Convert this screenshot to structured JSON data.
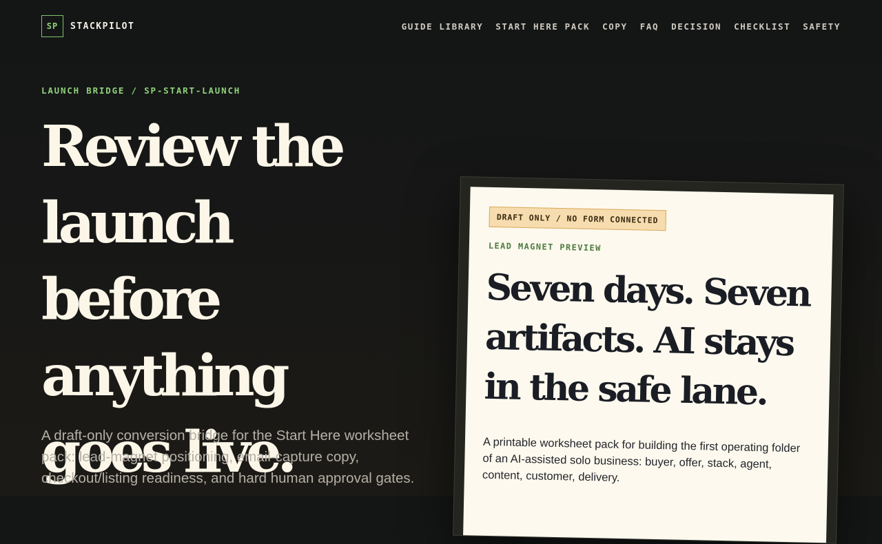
{
  "brand": {
    "mark": "SP",
    "name": "STACKPILOT"
  },
  "nav": {
    "items": [
      {
        "label": "GUIDE LIBRARY"
      },
      {
        "label": "START HERE PACK"
      },
      {
        "label": "COPY"
      },
      {
        "label": "FAQ"
      },
      {
        "label": "DECISION"
      },
      {
        "label": "CHECKLIST"
      },
      {
        "label": "SAFETY"
      }
    ]
  },
  "hero": {
    "eyebrow": "LAUNCH BRIDGE / SP-START-LAUNCH",
    "title": "Review the launch before anything goes live.",
    "subtitle": "A draft-only conversion bridge for the Start Here worksheet pack: lead-magnet positioning, email-capture copy, checkout/listing readiness, and hard human approval gates."
  },
  "preview": {
    "badge": "DRAFT ONLY / NO FORM CONNECTED",
    "label": "LEAD MAGNET PREVIEW",
    "title": "Seven days. Seven artifacts. AI stays in the safe lane.",
    "text": "A printable worksheet pack for building the first operating folder of an AI-assisted solo business: buyer, offer, stack, agent, content, customer, delivery."
  },
  "colors": {
    "accent": "#8fd17a",
    "background": "#151616",
    "card": "#fdf9ee",
    "badge": "#f6dcae"
  }
}
